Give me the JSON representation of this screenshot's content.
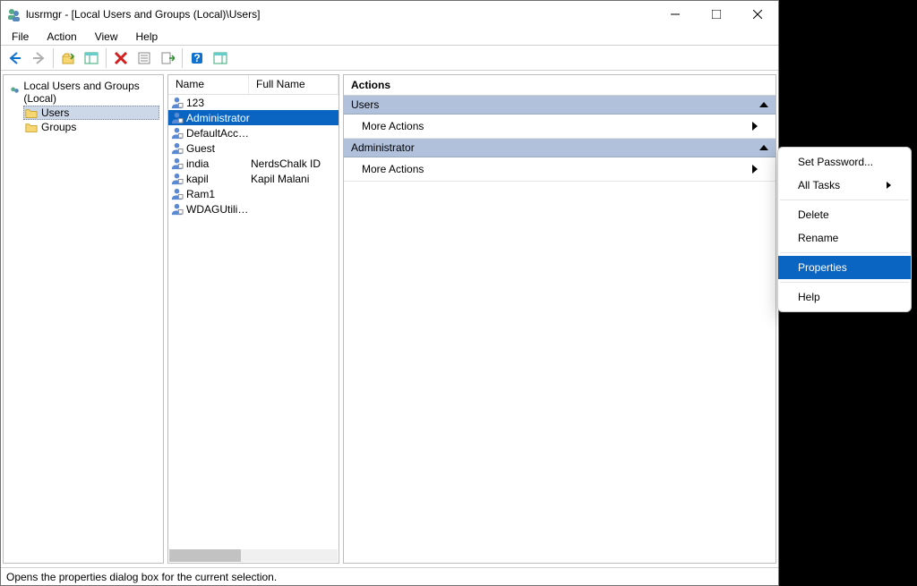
{
  "title": "lusrmgr - [Local Users and Groups (Local)\\Users]",
  "menu": {
    "file": "File",
    "action": "Action",
    "view": "View",
    "help": "Help"
  },
  "tree": {
    "root": "Local Users and Groups (Local)",
    "users": "Users",
    "groups": "Groups"
  },
  "list": {
    "cols": {
      "name": "Name",
      "fullname": "Full Name"
    },
    "rows": [
      {
        "name": "123",
        "full": ""
      },
      {
        "name": "Administrator",
        "full": ""
      },
      {
        "name": "DefaultAcco...",
        "full": ""
      },
      {
        "name": "Guest",
        "full": ""
      },
      {
        "name": "india",
        "full": "NerdsChalk ID"
      },
      {
        "name": "kapil",
        "full": "Kapil Malani"
      },
      {
        "name": "Ram1",
        "full": ""
      },
      {
        "name": "WDAGUtility...",
        "full": ""
      }
    ],
    "selected_index": 1
  },
  "actions": {
    "title": "Actions",
    "group1": "Users",
    "group2": "Administrator",
    "more": "More Actions"
  },
  "context_menu": {
    "items": [
      {
        "label": "Set Password...",
        "type": "item"
      },
      {
        "label": "All Tasks",
        "type": "submenu"
      },
      {
        "type": "sep"
      },
      {
        "label": "Delete",
        "type": "item"
      },
      {
        "label": "Rename",
        "type": "item"
      },
      {
        "type": "sep"
      },
      {
        "label": "Properties",
        "type": "item",
        "selected": true
      },
      {
        "type": "sep"
      },
      {
        "label": "Help",
        "type": "item"
      }
    ]
  },
  "statusbar": "Opens the properties dialog box for the current selection."
}
